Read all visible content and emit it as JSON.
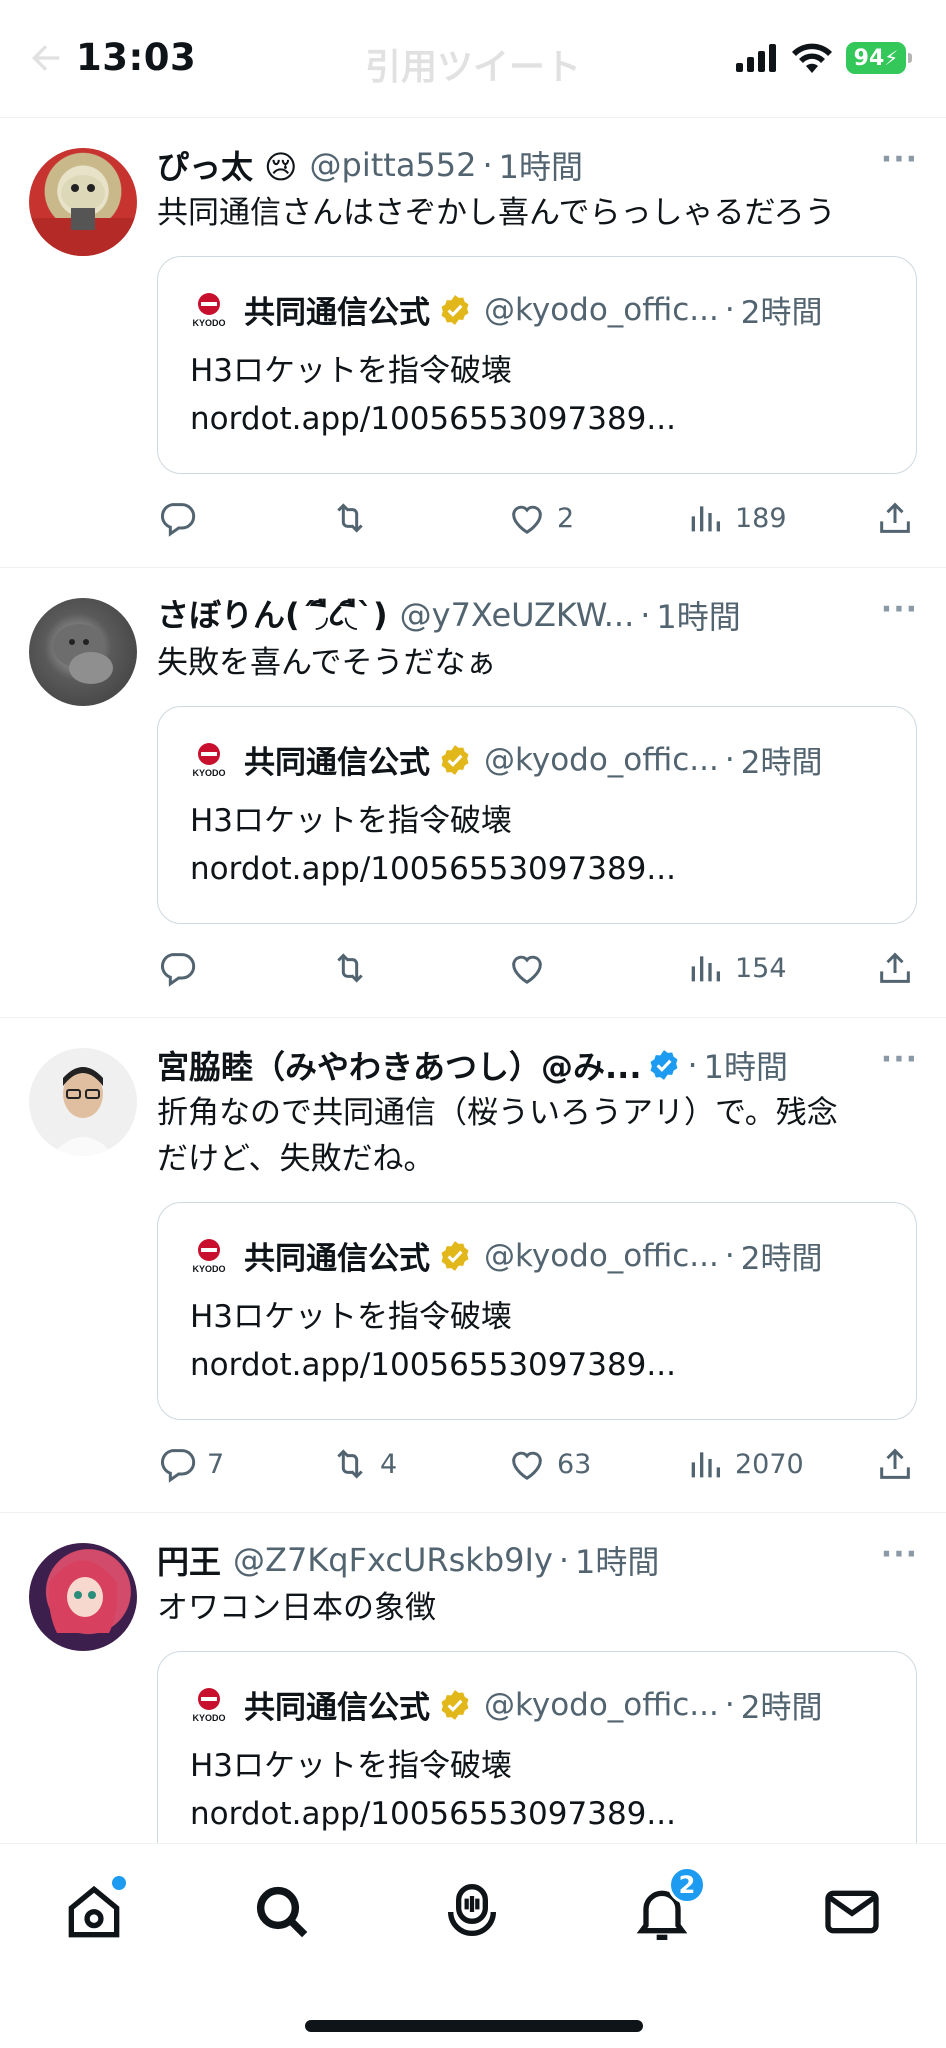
{
  "status_bar": {
    "time": "13:03",
    "battery": "94"
  },
  "header": {
    "title": "引用ツイート"
  },
  "quoted": {
    "name": "共同通信公式",
    "handle": "@kyodo_offic...",
    "dot": "·",
    "time": "2時間",
    "text_line1": "H3ロケットを指令破壊",
    "text_line2": "nordot.app/10056553097389...",
    "logo_text": "KYODO"
  },
  "tweets": [
    {
      "name": "ぴっ太 😢",
      "handle": "@pitta552",
      "dot": "·",
      "time": "1時間",
      "more": "···",
      "text": "共同通信さんはさぞかし喜んでらっしゃるだろう",
      "replies": "",
      "retweets": "",
      "likes": "2",
      "views": "189"
    },
    {
      "name": "さぼりん(´◞ื८◟ื`)",
      "handle": "@y7XeUZKW...",
      "dot": "·",
      "time": "1時間",
      "more": "···",
      "text": "失敗を喜んでそうだなぁ",
      "replies": "",
      "retweets": "",
      "likes": "",
      "views": "154"
    },
    {
      "name": "宮脇睦（みやわきあつし）@み...",
      "handle": "",
      "dot": "·",
      "time": "1時間",
      "more": "···",
      "text_line1": "折角なので共同通信（桜ういろうアリ）で。残念",
      "text_line2": "だけど、失敗だね。",
      "replies": "7",
      "retweets": "4",
      "likes": "63",
      "views": "2070"
    },
    {
      "name": "円王",
      "handle": "@Z7KqFxcURskb9Iy",
      "dot": "·",
      "time": "1時間",
      "more": "···",
      "text": "オワコン日本の象徴"
    }
  ],
  "tabbar": {
    "notifications_badge": "2"
  },
  "colors": {
    "accent": "#1d9bf0",
    "verified_gold": "#e2b719",
    "muted": "#536471"
  }
}
